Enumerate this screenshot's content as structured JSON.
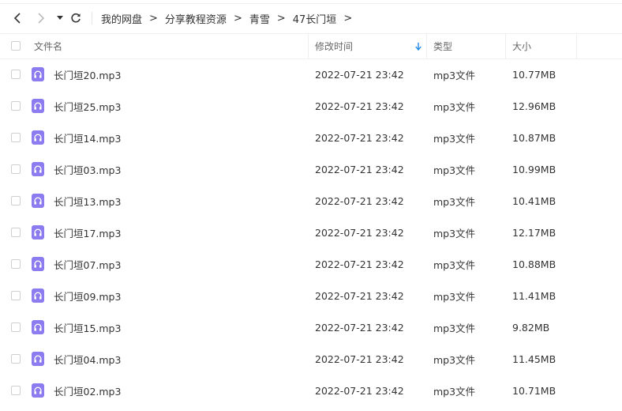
{
  "breadcrumb": [
    "我的网盘",
    "分享教程资源",
    "青雪",
    "47长门垣"
  ],
  "breadcrumb_separator": ">",
  "columns": {
    "name": "文件名",
    "modified": "修改时间",
    "type": "类型",
    "size": "大小"
  },
  "sort": {
    "column": "modified",
    "direction": "descending"
  },
  "colors": {
    "accent": "#1e88e5",
    "audio_icon": "#8c7cf0"
  },
  "files": [
    {
      "name": "长门垣20.mp3",
      "modified": "2022-07-21 23:42",
      "type": "mp3文件",
      "size": "10.77MB"
    },
    {
      "name": "长门垣25.mp3",
      "modified": "2022-07-21 23:42",
      "type": "mp3文件",
      "size": "12.96MB"
    },
    {
      "name": "长门垣14.mp3",
      "modified": "2022-07-21 23:42",
      "type": "mp3文件",
      "size": "10.87MB"
    },
    {
      "name": "长门垣03.mp3",
      "modified": "2022-07-21 23:42",
      "type": "mp3文件",
      "size": "10.99MB"
    },
    {
      "name": "长门垣13.mp3",
      "modified": "2022-07-21 23:42",
      "type": "mp3文件",
      "size": "10.41MB"
    },
    {
      "name": "长门垣17.mp3",
      "modified": "2022-07-21 23:42",
      "type": "mp3文件",
      "size": "12.17MB"
    },
    {
      "name": "长门垣07.mp3",
      "modified": "2022-07-21 23:42",
      "type": "mp3文件",
      "size": "10.88MB"
    },
    {
      "name": "长门垣09.mp3",
      "modified": "2022-07-21 23:42",
      "type": "mp3文件",
      "size": "11.41MB"
    },
    {
      "name": "长门垣15.mp3",
      "modified": "2022-07-21 23:42",
      "type": "mp3文件",
      "size": "9.82MB"
    },
    {
      "name": "长门垣04.mp3",
      "modified": "2022-07-21 23:42",
      "type": "mp3文件",
      "size": "11.45MB"
    },
    {
      "name": "长门垣02.mp3",
      "modified": "2022-07-21 23:42",
      "type": "mp3文件",
      "size": "10.71MB"
    }
  ]
}
